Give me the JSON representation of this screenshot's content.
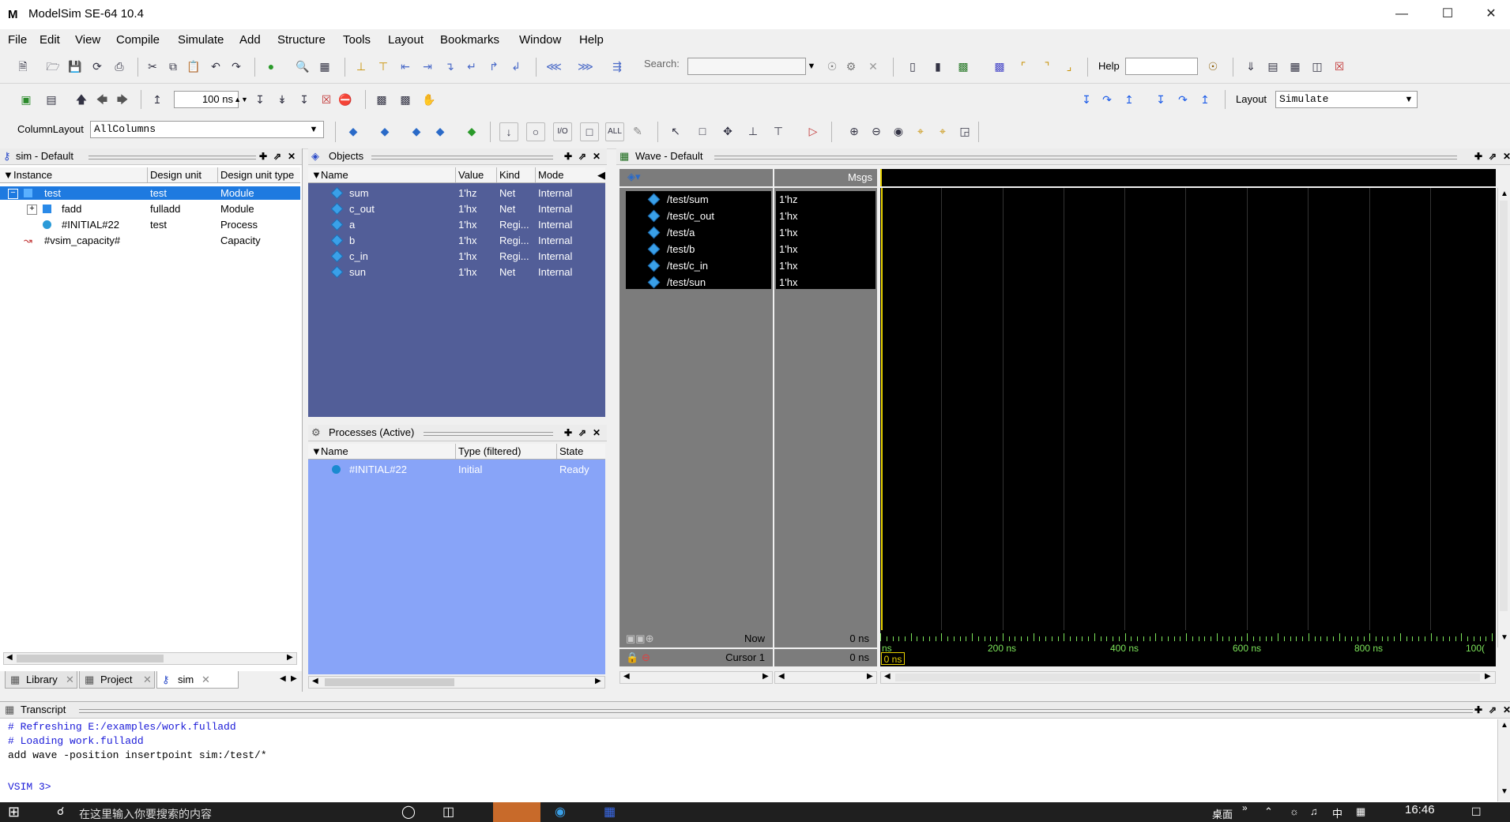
{
  "window": {
    "title": "ModelSim SE-64 10.4",
    "logo": "M",
    "controls": [
      "minimize-icon",
      "maximize-icon",
      "close-icon"
    ]
  },
  "menu": [
    "File",
    "Edit",
    "View",
    "Compile",
    "Simulate",
    "Add",
    "Structure",
    "Tools",
    "Layout",
    "Bookmarks",
    "Window",
    "Help"
  ],
  "toolbar": {
    "search_label": "Search:",
    "search_value": "",
    "help_label": "Help",
    "help_value": "",
    "run_length": "100 ns",
    "layout_label": "Layout",
    "layout_value": "Simulate",
    "column_layout_label": "ColumnLayout",
    "column_layout_value": "AllColumns"
  },
  "sim_pane": {
    "title": "sim - Default",
    "columns": [
      "Instance",
      "Design unit",
      "Design unit type"
    ],
    "rows": [
      {
        "instance": "test",
        "design_unit": "test",
        "type": "Module",
        "expander": "−",
        "selected": true
      },
      {
        "instance": "fadd",
        "design_unit": "fulladd",
        "type": "Module",
        "expander": "+",
        "selected": false
      },
      {
        "instance": "#INITIAL#22",
        "design_unit": "test",
        "type": "Process",
        "expander": "",
        "selected": false
      },
      {
        "instance": "#vsim_capacity#",
        "design_unit": "",
        "type": "Capacity",
        "expander": "",
        "selected": false
      }
    ],
    "tabs": [
      "Library",
      "Project",
      "sim"
    ]
  },
  "objects_pane": {
    "title": "Objects",
    "columns": [
      "Name",
      "Value",
      "Kind",
      "Mode"
    ],
    "rows": [
      {
        "name": "sum",
        "value": "1'hz",
        "kind": "Net",
        "mode": "Internal"
      },
      {
        "name": "c_out",
        "value": "1'hx",
        "kind": "Net",
        "mode": "Internal"
      },
      {
        "name": "a",
        "value": "1'hx",
        "kind": "Regi...",
        "mode": "Internal"
      },
      {
        "name": "b",
        "value": "1'hx",
        "kind": "Regi...",
        "mode": "Internal"
      },
      {
        "name": "c_in",
        "value": "1'hx",
        "kind": "Regi...",
        "mode": "Internal"
      },
      {
        "name": "sun",
        "value": "1'hx",
        "kind": "Net",
        "mode": "Internal"
      }
    ]
  },
  "processes_pane": {
    "title": "Processes (Active)",
    "columns": [
      "Name",
      "Type (filtered)",
      "State"
    ],
    "rows": [
      {
        "name": "#INITIAL#22",
        "type": "Initial",
        "state": "Ready"
      }
    ]
  },
  "wave_pane": {
    "title": "Wave - Default",
    "msgs_label": "Msgs",
    "signals": [
      {
        "name": "/test/sum",
        "value": "1'hz"
      },
      {
        "name": "/test/c_out",
        "value": "1'hx"
      },
      {
        "name": "/test/a",
        "value": "1'hx"
      },
      {
        "name": "/test/b",
        "value": "1'hx"
      },
      {
        "name": "/test/c_in",
        "value": "1'hx"
      },
      {
        "name": "/test/sun",
        "value": "1'hx"
      }
    ],
    "now_label": "Now",
    "now_value": "0 ns",
    "cursor_label": "Cursor 1",
    "cursor_value": "0 ns",
    "cursor_time_box": "0 ns",
    "timeline_labels": [
      "ns",
      "200 ns",
      "400 ns",
      "600 ns",
      "800 ns",
      "100("
    ],
    "colors": {
      "background": "#000000",
      "grid": "#333333",
      "cursor": "#e8d200",
      "ruler": "#7ce45a"
    }
  },
  "transcript": {
    "title": "Transcript",
    "lines": [
      {
        "text": "# Refreshing E:/examples/work.fulladd",
        "color": "#1a1ad8"
      },
      {
        "text": "# Loading work.fulladd",
        "color": "#1a1ad8"
      },
      {
        "text": "add wave -position insertpoint sim:/test/*",
        "color": "#000000"
      }
    ],
    "prompt": "VSIM 3>"
  },
  "taskbar": {
    "search_placeholder": "在这里输入你要搜索的内容",
    "clock": "16:46",
    "tray_label": "桌面"
  }
}
